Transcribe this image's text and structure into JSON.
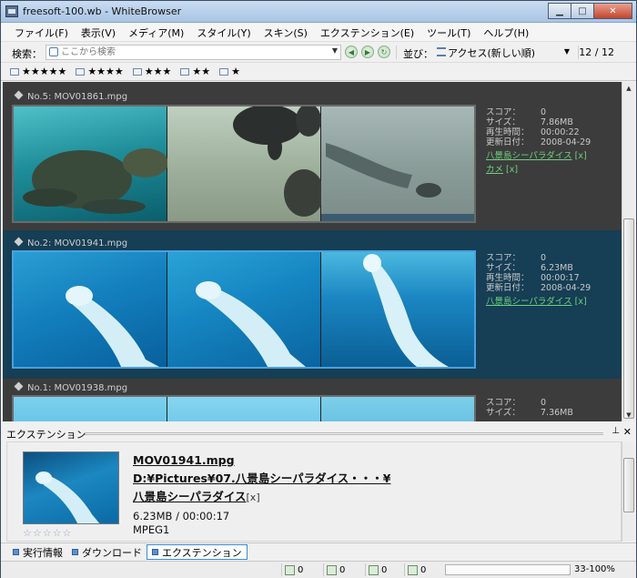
{
  "window": {
    "title": "freesoft-100.wb - WhiteBrowser"
  },
  "menu": [
    "ファイル(F)",
    "表示(V)",
    "メディア(M)",
    "スタイル(Y)",
    "スキン(S)",
    "エクステンション(E)",
    "ツール(T)",
    "ヘルプ(H)"
  ],
  "toolbar": {
    "search_label": "検索：",
    "search_placeholder": "ここから検索",
    "sort_label": "並び：",
    "sort_value": "アクセス(新しい順)",
    "count": "12 / 12"
  },
  "rating_filters": [
    "★★★★★",
    "★★★★",
    "★★★",
    "★★",
    "★"
  ],
  "entries": [
    {
      "title": "No.5: MOV01861.mpg",
      "score_label": "スコア：",
      "score": "0",
      "size_label": "サイズ：",
      "size": "7.86MB",
      "duration_label": "再生時間：",
      "duration": "00:00:22",
      "date_label": "更新日付：",
      "date": "2008-04-29",
      "tags": [
        "八景島シーパラダイス",
        "カメ"
      ]
    },
    {
      "title": "No.2: MOV01941.mpg",
      "score_label": "スコア：",
      "score": "0",
      "size_label": "サイズ：",
      "size": "6.23MB",
      "duration_label": "再生時間：",
      "duration": "00:00:17",
      "date_label": "更新日付：",
      "date": "2008-04-29",
      "tags": [
        "八景島シーパラダイス"
      ]
    },
    {
      "title": "No.1: MOV01938.mpg",
      "score_label": "スコア：",
      "score": "0",
      "size_label": "サイズ：",
      "size": "7.36MB"
    }
  ],
  "extension": {
    "header": "エクステンション",
    "filename": "MOV01941.mpg",
    "path": "D:¥Pictures¥07.八景島シーパラダイス・・・¥",
    "tag": "八景島シーパラダイス",
    "tag_remove": "[x]",
    "size_duration": "6.23MB / 00:00:17",
    "codec": "MPEG1",
    "stars": "☆☆☆☆☆"
  },
  "tabs": [
    "実行情報",
    "ダウンロード",
    "エクステンション"
  ],
  "status": {
    "counts": [
      "0",
      "0",
      "0",
      "0"
    ],
    "zoom": "33-100%"
  },
  "colors": {
    "list_bg": "#3c3c3c",
    "selected_bg": "#163e54",
    "tag_color": "#6ed07e",
    "water_turtle": "#2b9aa8",
    "water_beluga": "#1d86c0"
  }
}
